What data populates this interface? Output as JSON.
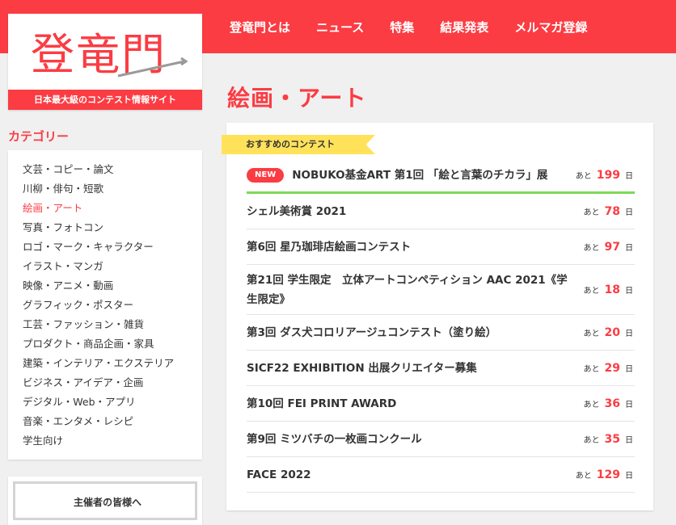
{
  "site": {
    "logo_text": "登竜門",
    "tagline": "日本最大級のコンテスト情報サイト",
    "accent_color": "#fb3c43"
  },
  "nav": {
    "items": [
      {
        "label": "登竜門とは"
      },
      {
        "label": "ニュース"
      },
      {
        "label": "特集"
      },
      {
        "label": "結果発表"
      },
      {
        "label": "メルマガ登録"
      }
    ]
  },
  "sidebar": {
    "heading": "カテゴリー",
    "categories": [
      {
        "label": "文芸・コピー・論文"
      },
      {
        "label": "川柳・俳句・短歌"
      },
      {
        "label": "絵画・アート",
        "active": true
      },
      {
        "label": "写真・フォトコン"
      },
      {
        "label": "ロゴ・マーク・キャラクター"
      },
      {
        "label": "イラスト・マンガ"
      },
      {
        "label": "映像・アニメ・動画"
      },
      {
        "label": "グラフィック・ポスター"
      },
      {
        "label": "工芸・ファッション・雑貨"
      },
      {
        "label": "プロダクト・商品企画・家具"
      },
      {
        "label": "建築・インテリア・エクステリア"
      },
      {
        "label": "ビジネス・アイデア・企画"
      },
      {
        "label": "デジタル・Web・アプリ"
      },
      {
        "label": "音楽・エンタメ・レシピ"
      },
      {
        "label": "学生向け"
      }
    ],
    "organizer_label": "主催者の皆様へ"
  },
  "main": {
    "title": "絵画・アート",
    "ribbon_label": "おすすめのコンテスト",
    "days_prefix": "あと",
    "days_suffix": "日",
    "new_badge": "NEW",
    "contests": [
      {
        "title": "NOBUKO基金ART 第1回 「絵と言葉のチカラ」展",
        "days": "199",
        "is_new": true
      },
      {
        "title": "シェル美術賞 2021",
        "days": "78"
      },
      {
        "title": "第6回 星乃珈琲店絵画コンテスト",
        "days": "97"
      },
      {
        "title": "第21回 学生限定　立体アートコンペティション AAC 2021《学生限定》",
        "days": "18"
      },
      {
        "title": "第3回 ダス犬コロリアージュコンテスト（塗り絵）",
        "days": "20"
      },
      {
        "title": "SICF22 EXHIBITION 出展クリエイター募集",
        "days": "29"
      },
      {
        "title": "第10回 FEI PRINT AWARD",
        "days": "36"
      },
      {
        "title": "第9回 ミツバチの一枚画コンクール",
        "days": "35"
      },
      {
        "title": "FACE 2022",
        "days": "129"
      }
    ]
  }
}
